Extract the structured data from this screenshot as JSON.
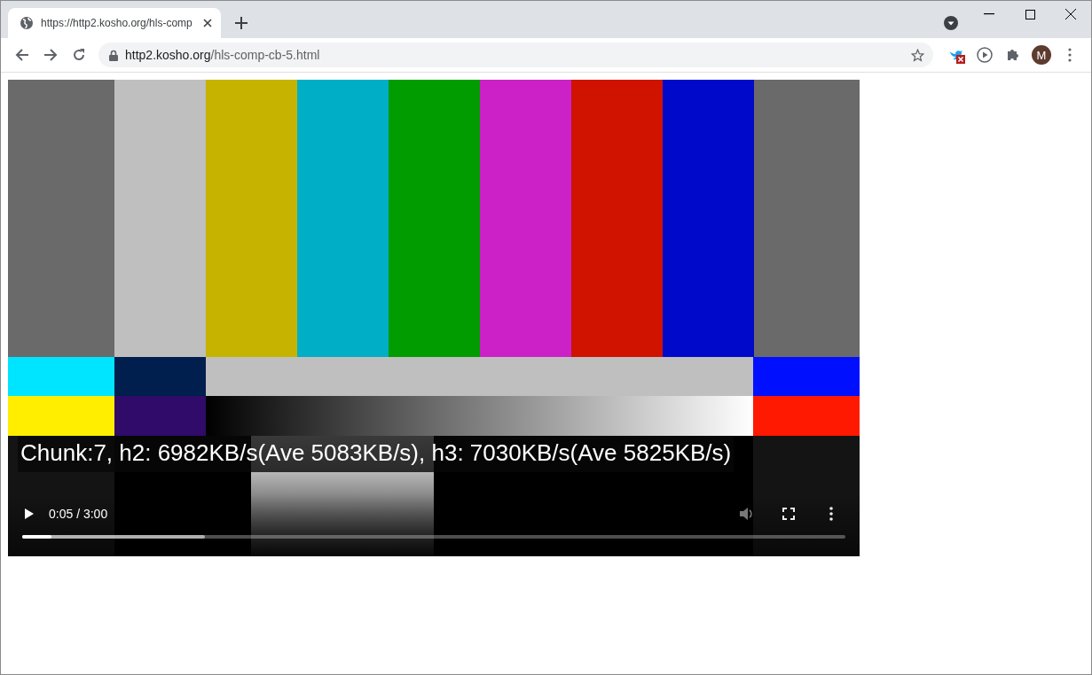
{
  "tab": {
    "title": "https://http2.kosho.org/hls-comp",
    "selected": true
  },
  "address_bar": {
    "host": "http2.kosho.org",
    "path": "/hls-comp-cb-5.html"
  },
  "profile": {
    "initial": "M"
  },
  "video": {
    "caption": "Chunk:7, h2: 6982KB/s(Ave 5083KB/s), h3: 7030KB/s(Ave 5825KB/s)",
    "time": "0:05 / 3:00",
    "progress": {
      "level": 0.036
    },
    "buffered": {
      "level": 0.222
    }
  }
}
